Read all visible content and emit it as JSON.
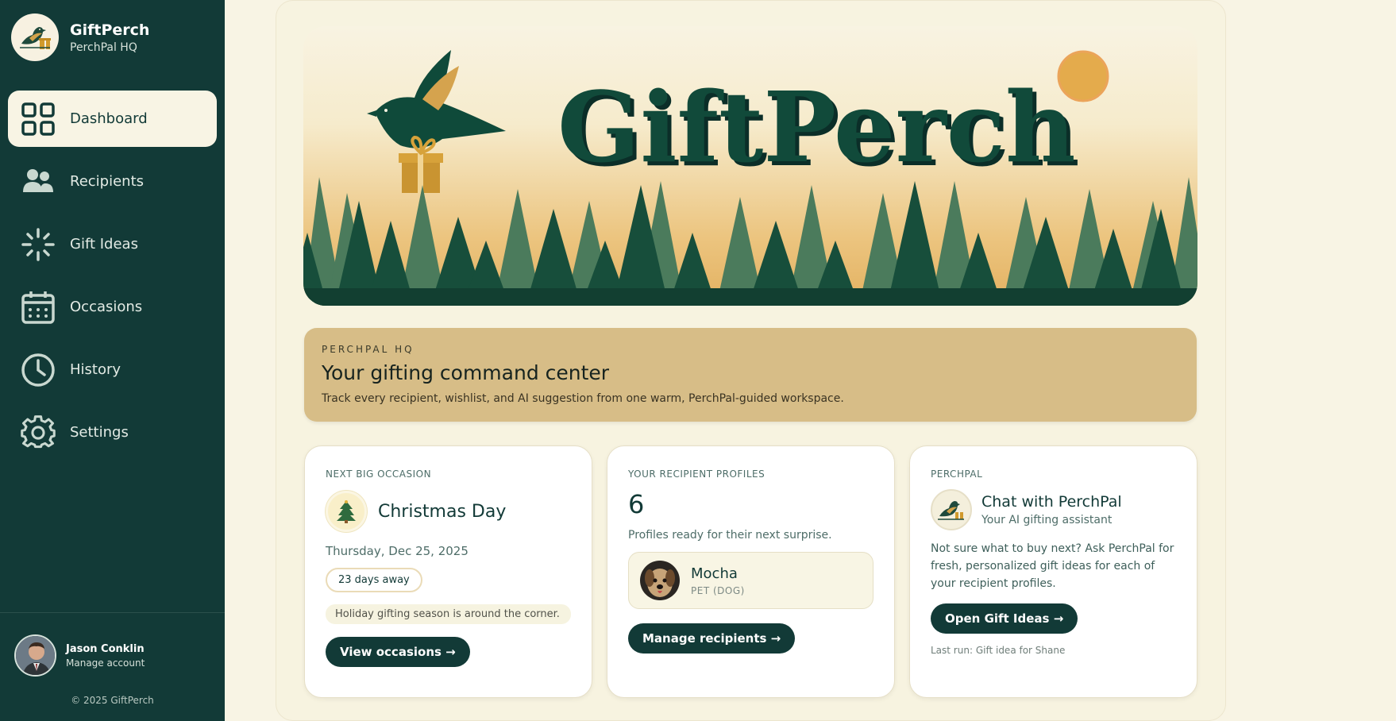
{
  "brand": {
    "name": "GiftPerch",
    "subtitle": "PerchPal HQ"
  },
  "nav": {
    "items": [
      {
        "label": "Dashboard",
        "icon": "grid-icon",
        "active": true
      },
      {
        "label": "Recipients",
        "icon": "people-icon"
      },
      {
        "label": "Gift Ideas",
        "icon": "sparkle-icon"
      },
      {
        "label": "Occasions",
        "icon": "calendar-icon"
      },
      {
        "label": "History",
        "icon": "clock-icon"
      },
      {
        "label": "Settings",
        "icon": "gear-icon"
      }
    ]
  },
  "account": {
    "name": "Jason Conklin",
    "action": "Manage account"
  },
  "footer": {
    "copyright": "© 2025 GiftPerch"
  },
  "hero": {
    "logo_text": "GiftPerch"
  },
  "banner": {
    "eyebrow": "PERCHPAL HQ",
    "title": "Your gifting command center",
    "description": "Track every recipient, wishlist, and AI suggestion from one warm, PerchPal-guided workspace."
  },
  "occasion_card": {
    "eyebrow": "NEXT BIG OCCASION",
    "title": "Christmas Day",
    "date": "Thursday, Dec 25, 2025",
    "countdown": "23 days away",
    "note": "Holiday gifting season is around the corner.",
    "button": "View occasions →"
  },
  "recipients_card": {
    "eyebrow": "YOUR RECIPIENT PROFILES",
    "count": "6",
    "description": "Profiles ready for their next surprise.",
    "profile_name": "Mocha",
    "profile_type": "PET (DOG)",
    "button": "Manage recipients →"
  },
  "perchpal_card": {
    "eyebrow": "PERCHPAL",
    "title": "Chat with PerchPal",
    "subtitle": "Your AI gifting assistant",
    "description": "Not sure what to buy next? Ask PerchPal for fresh, personalized gift ideas for each of your recipient profiles.",
    "button": "Open Gift Ideas →",
    "last_run": "Last run: Gift idea for Shane"
  },
  "colors": {
    "sidebar": "#123a37",
    "background": "#f8f4e4",
    "accent": "#d7bd87",
    "primary_button": "#123a37"
  }
}
